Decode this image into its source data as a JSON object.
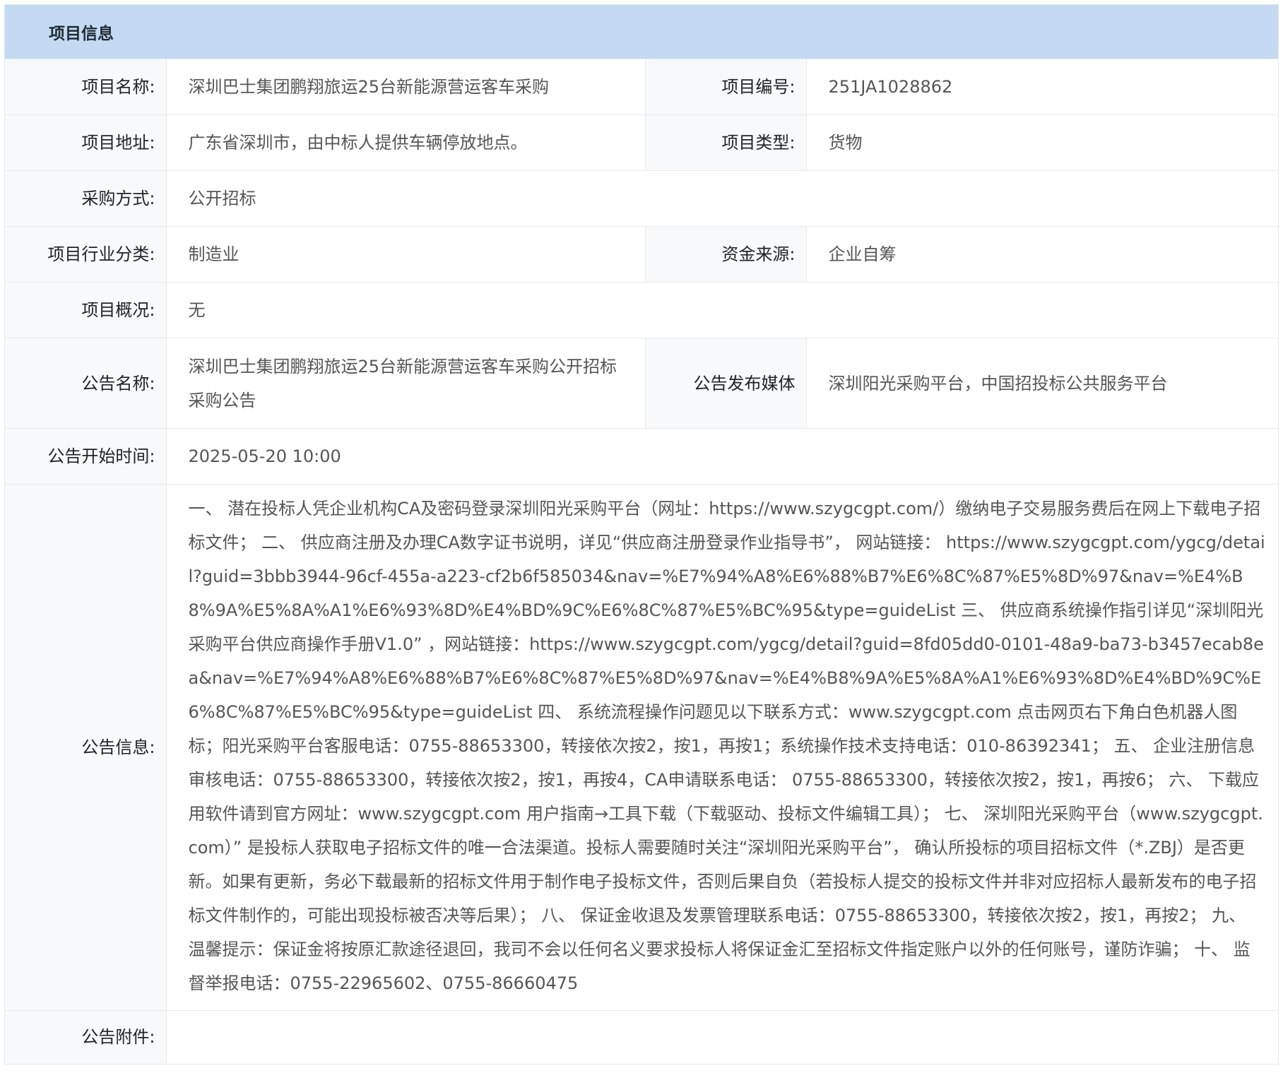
{
  "panel": {
    "title": "项目信息"
  },
  "fields": {
    "project_name": {
      "label": "项目名称:",
      "value": "深圳巴士集团鹏翔旅运25台新能源营运客车采购"
    },
    "project_no": {
      "label": "项目编号:",
      "value": "251JA1028862"
    },
    "project_address": {
      "label": "项目地址:",
      "value": "广东省深圳市，由中标人提供车辆停放地点。"
    },
    "project_type": {
      "label": "项目类型:",
      "value": "货物"
    },
    "purchase_method": {
      "label": "采购方式:",
      "value": "公开招标"
    },
    "industry": {
      "label": "项目行业分类:",
      "value": "制造业"
    },
    "fund_source": {
      "label": "资金来源:",
      "value": "企业自筹"
    },
    "overview": {
      "label": "项目概况:",
      "value": "无"
    },
    "notice_name": {
      "label": "公告名称:",
      "value": "深圳巴士集团鹏翔旅运25台新能源营运客车采购公开招标采购公告"
    },
    "notice_media": {
      "label": "公告发布媒体",
      "value": "深圳阳光采购平台，中国招投标公共服务平台"
    },
    "notice_start": {
      "label": "公告开始时间:",
      "value": "2025-05-20 10:00"
    },
    "notice_info": {
      "label": "公告信息:",
      "value": "一、 潜在投标人凭企业机构CA及密码登录深圳阳光采购平台（网址：https://www.szygcgpt.com/）缴纳电子交易服务费后在网上下载电子招标文件； 二、 供应商注册及办理CA数字证书说明，详见“供应商注册登录作业指导书”， 网站链接： https://www.szygcgpt.com/ygcg/detail?guid=3bbb3944-96cf-455a-a223-cf2b6f585034&nav=%E7%94%A8%E6%88%B7%E6%8C%87%E5%8D%97&nav=%E4%B8%9A%E5%8A%A1%E6%93%8D%E4%BD%9C%E6%8C%87%E5%BC%95&type=guideList 三、 供应商系统操作指引详见“深圳阳光采购平台供应商操作手册V1.0” ，网站链接：https://www.szygcgpt.com/ygcg/detail?guid=8fd05dd0-0101-48a9-ba73-b3457ecab8ea&nav=%E7%94%A8%E6%88%B7%E6%8C%87%E5%8D%97&nav=%E4%B8%9A%E5%8A%A1%E6%93%8D%E4%BD%9C%E6%8C%87%E5%BC%95&type=guideList 四、 系统流程操作问题见以下联系方式：www.szygcgpt.com 点击网页右下角白色机器人图标；阳光采购平台客服电话：0755-88653300，转接依次按2，按1，再按1；系统操作技术支持电话：010-86392341； 五、 企业注册信息审核电话：0755-88653300，转接依次按2，按1，再按4，CA申请联系电话： 0755-88653300，转接依次按2，按1，再按6； 六、 下载应用软件请到官方网址：www.szygcgpt.com 用户指南→工具下载（下载驱动、投标文件编辑工具）； 七、 深圳阳光采购平台（www.szygcgpt.com）” 是投标人获取电子招标文件的唯一合法渠道。投标人需要随时关注“深圳阳光采购平台”， 确认所投标的项目招标文件（*.ZBJ）是否更新。如果有更新，务必下载最新的招标文件用于制作电子投标文件，否则后果自负（若投标人提交的投标文件并非对应招标人最新发布的电子招标文件制作的，可能出现投标被否决等后果）； 八、 保证金收退及发票管理联系电话：0755-88653300，转接依次按2，按1，再按2； 九、 温馨提示：保证金将按原汇款途径退回，我司不会以任何名义要求投标人将保证金汇至招标文件指定账户以外的任何账号，谨防诈骗； 十、 监督举报电话：0755-22965602、0755-86660475"
    },
    "attachment": {
      "label": "公告附件:",
      "value": ""
    }
  }
}
